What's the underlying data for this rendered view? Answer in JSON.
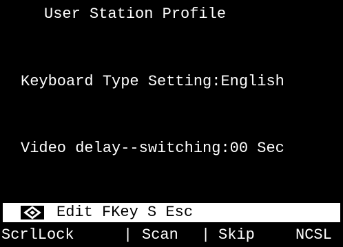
{
  "screen": {
    "title": "User Station Profile",
    "keyboard_label": "Keyboard Type Setting:",
    "keyboard_value": "English",
    "video_label": "Video delay--switching:",
    "video_value": "00 Sec"
  },
  "hint_bar": {
    "icon": "diamond-key-icon",
    "text": "Edit FKey S Esc"
  },
  "footer": {
    "scrolllock": "ScrlLock",
    "separator": "|",
    "scan": "Scan",
    "skip": "Skip",
    "ncsl": "NCSL"
  },
  "colors": {
    "background": "#000000",
    "text": "#ffffff",
    "hint_bar_bg": "#ffffff",
    "hint_bar_text": "#000000"
  }
}
